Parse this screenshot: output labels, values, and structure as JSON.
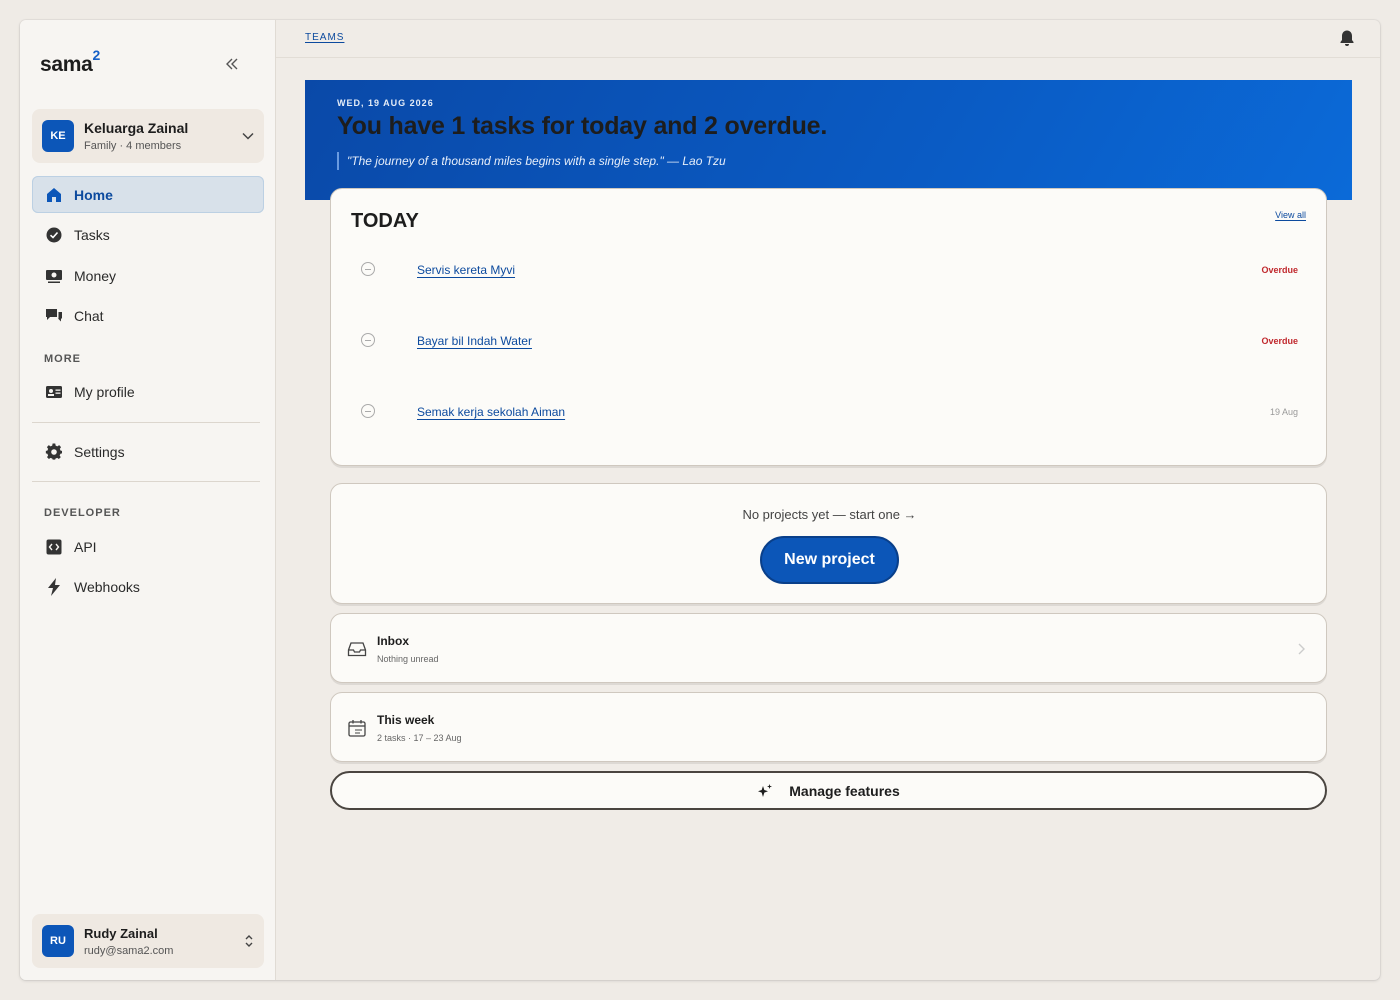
{
  "brand": {
    "name": "sama",
    "superscript": "2"
  },
  "sidebar": {
    "team": {
      "initials": "KE",
      "name": "Keluarga Zainal",
      "subtitle": "Family · 4 members"
    },
    "items": [
      {
        "label": "Home",
        "icon": "home-icon",
        "active": true
      },
      {
        "label": "Tasks",
        "icon": "check-circle-icon"
      },
      {
        "label": "Money",
        "icon": "money-icon"
      },
      {
        "label": "Chat",
        "icon": "chat-icon"
      }
    ],
    "more_label": "MORE",
    "more_items": [
      {
        "label": "My profile",
        "icon": "id-card-icon"
      }
    ],
    "settings_label": "Settings",
    "developer_label": "DEVELOPER",
    "developer_items": [
      {
        "label": "API",
        "icon": "code-icon"
      },
      {
        "label": "Webhooks",
        "icon": "lightning-icon"
      }
    ],
    "user": {
      "initials": "RU",
      "name": "Rudy Zainal",
      "email": "rudy@sama2.com"
    }
  },
  "topbar": {
    "breadcrumb": "TEAMS"
  },
  "hero": {
    "date": "WED, 19 AUG 2026",
    "title": "You have 1 tasks for today and 2 overdue.",
    "quote": "\"The journey of a thousand miles begins with a single step.\" — Lao Tzu"
  },
  "today": {
    "title": "TODAY",
    "view_all": "View all",
    "tasks": [
      {
        "title": "Servis kereta Myvi",
        "status": "Overdue"
      },
      {
        "title": "Bayar bil Indah Water",
        "status": "Overdue"
      },
      {
        "title": "Semak kerja sekolah Aiman",
        "status": "19 Aug"
      }
    ]
  },
  "projects": {
    "empty_text": "No projects yet — start one →",
    "button": "New project"
  },
  "inbox": {
    "title": "Inbox",
    "subtitle": "Nothing unread"
  },
  "week": {
    "title": "This week",
    "subtitle": "2 tasks · 17 – 23 Aug"
  },
  "manage_features": "Manage features",
  "colors": {
    "accent": "#0c56b8",
    "overdue": "#c0282d",
    "hero": "#0a5bc4"
  }
}
